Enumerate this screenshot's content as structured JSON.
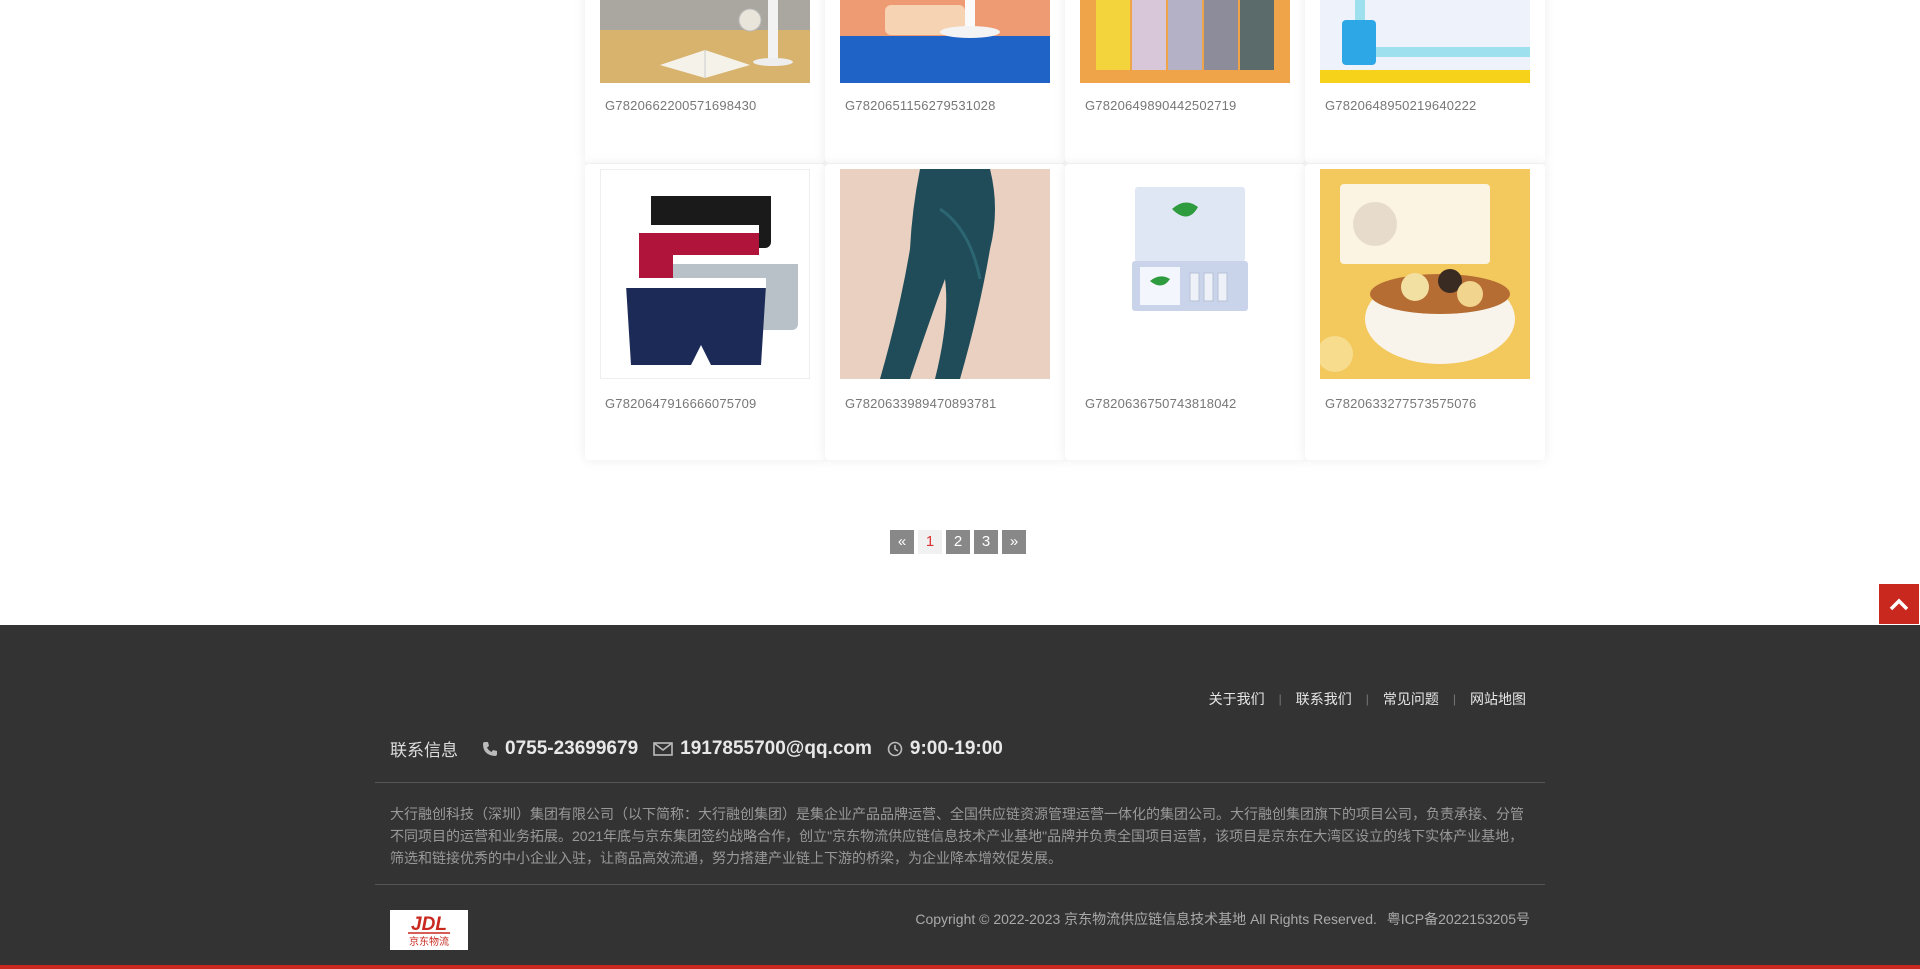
{
  "products": [
    {
      "code": "G7820662200571698430",
      "image": "desk-lamp-book"
    },
    {
      "code": "G7820651156279531028",
      "image": "desk-lamp-blue"
    },
    {
      "code": "G7820649890442502719",
      "image": "pants-colors"
    },
    {
      "code": "G7820648950219640222",
      "image": "blue-box"
    },
    {
      "code": "G7820647916666075709",
      "image": "boxer-briefs"
    },
    {
      "code": "G7820633989470893781",
      "image": "leggings"
    },
    {
      "code": "G7820636750743818042",
      "image": "skincare-kit"
    },
    {
      "code": "G7820633277573575076",
      "image": "food-bowl"
    }
  ],
  "pagination": {
    "prev": "«",
    "pages": [
      "1",
      "2",
      "3"
    ],
    "current": "1",
    "next": "»"
  },
  "back_to_top_icon": "chevron-up-icon",
  "footer": {
    "links": [
      "关于我们",
      "联系我们",
      "常见问题",
      "网站地图"
    ],
    "contact_label": "联系信息",
    "phone": "0755-23699679",
    "email": "1917855700@qq.com",
    "hours": "9:00-19:00",
    "description": "大行融创科技（深圳）集团有限公司（以下简称：大行融创集团）是集企业产品品牌运营、全国供应链资源管理运营一体化的集团公司。大行融创集团旗下的项目公司，负责承接、分管不同项目的运营和业务拓展。2021年底与京东集团签约战略合作，创立\"京东物流供应链信息技术产业基地\"品牌并负责全国项目运营，该项目是京东在大湾区设立的线下实体产业基地，筛选和链接优秀的中小企业入驻，让商品高效流通，努力搭建产业链上下游的桥梁，为企业降本增效促发展。",
    "logo_text": "JDL",
    "logo_sub": "京东物流",
    "copyright": "Copyright © 2022-2023 京东物流供应链信息技术基地 All Rights Reserved.",
    "icp": "粤ICP备2022153205号"
  },
  "colors": {
    "accent": "#c8281e",
    "footer_bg": "#333333",
    "pager_bg": "#888888"
  }
}
